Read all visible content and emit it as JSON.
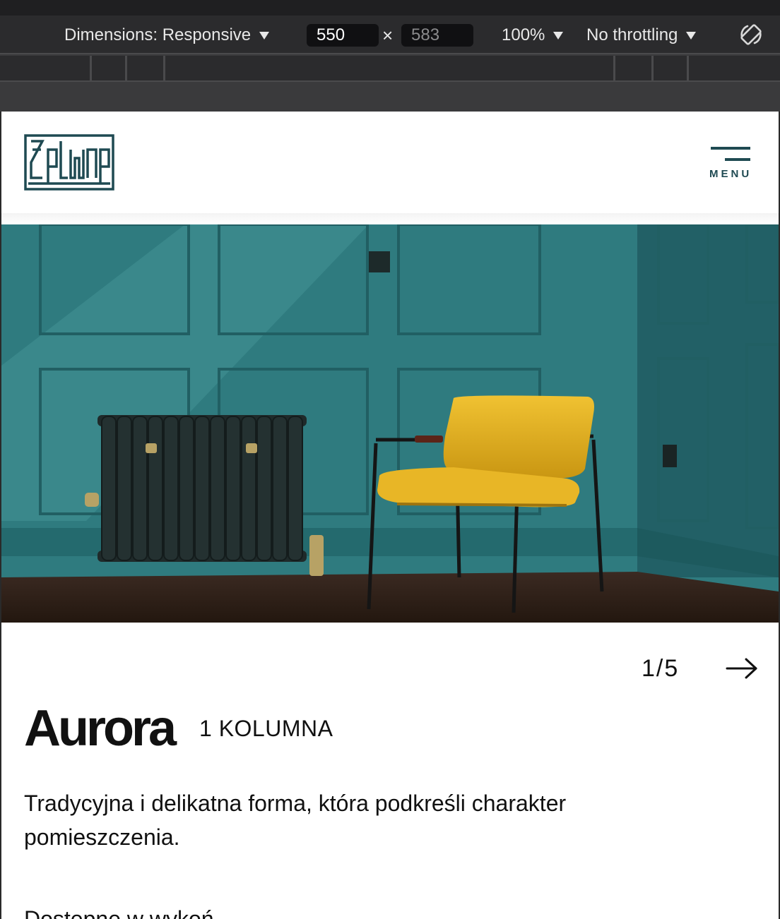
{
  "devtools": {
    "dimensions_label": "Dimensions: Responsive",
    "width": "550",
    "height": "583",
    "times": "×",
    "zoom": "100%",
    "throttling": "No throttling"
  },
  "header": {
    "logo_text": "żeliwne",
    "menu_label": "MENU"
  },
  "slider": {
    "counter": "1/5"
  },
  "product": {
    "name": "Aurora",
    "variant": "1 KOLUMNA",
    "description": "Tradycyjna i delikatna forma, która podkreśli charakter pomieszczenia.",
    "partial_text": "Dostępne w  wykoń"
  },
  "colors": {
    "brand": "#1f4a52",
    "wall": "#2e7c80",
    "chair": "#e6b422"
  }
}
